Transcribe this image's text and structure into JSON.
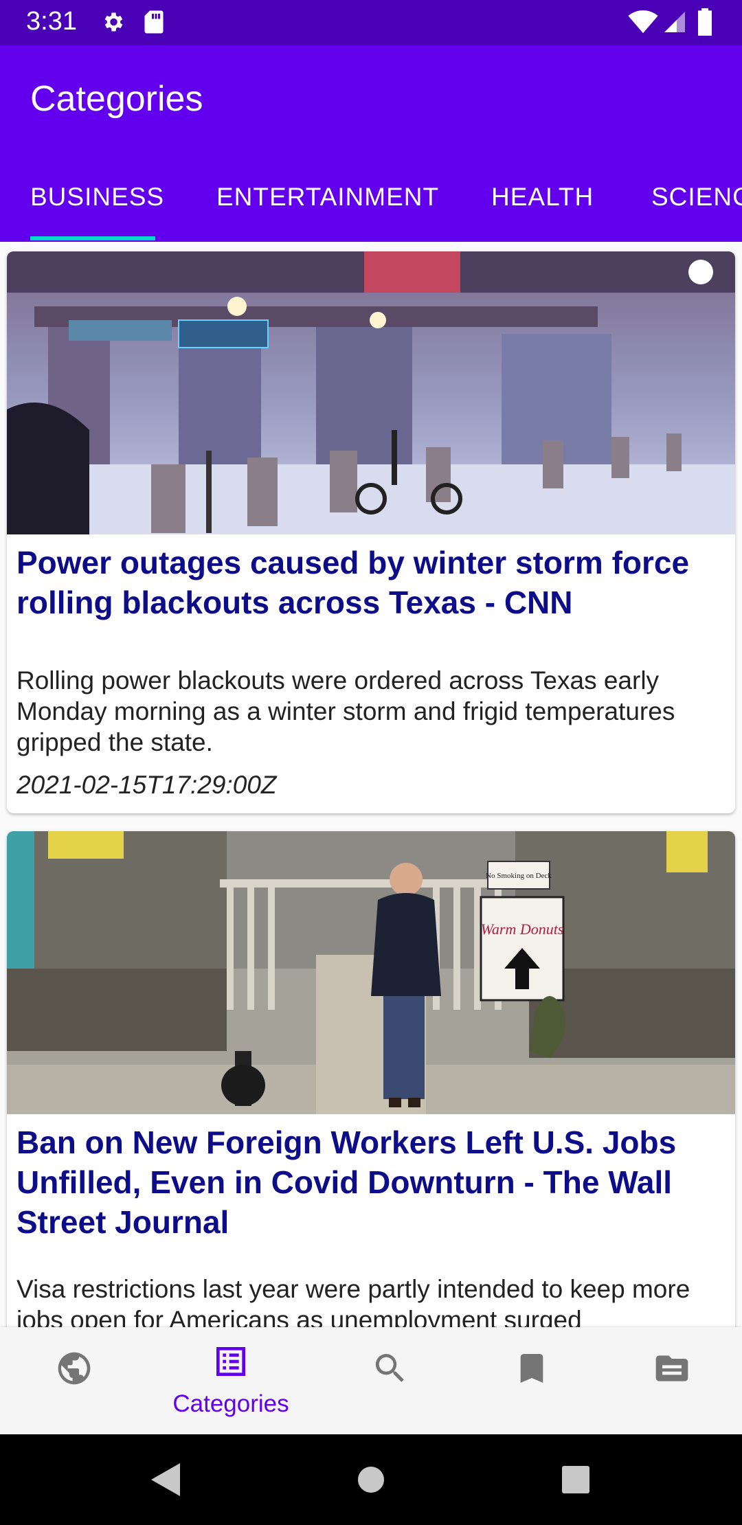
{
  "status_bar": {
    "time": "3:31",
    "icons": [
      "gear-icon",
      "sd-card-icon",
      "wifi-icon",
      "cellular-signal-icon",
      "battery-icon"
    ]
  },
  "app_bar": {
    "title": "Categories"
  },
  "tabs": [
    {
      "label": "BUSINESS",
      "selected": true
    },
    {
      "label": "ENTERTAINMENT",
      "selected": false
    },
    {
      "label": "HEALTH",
      "selected": false
    },
    {
      "label": "SCIENCE",
      "selected": false
    }
  ],
  "articles": [
    {
      "title": "Power outages caused by winter storm force rolling blackouts across Texas - CNN",
      "description": "Rolling power blackouts were ordered across Texas early Monday morning as a winter storm and frigid temperatures gripped the state.",
      "date": "2021-02-15T17:29:00Z"
    },
    {
      "title": "Ban on New Foreign Workers Left U.S. Jobs Unfilled, Even in Covid Downturn - The Wall Street Journal",
      "description": "Visa restrictions last year were partly intended to keep more jobs open for Americans as unemployment surged",
      "sign_top": "No Smoking on Deck",
      "sign_main": "Warm Donuts"
    }
  ],
  "bottom_nav": {
    "items": [
      {
        "icon": "globe-icon",
        "label": ""
      },
      {
        "icon": "list-icon",
        "label": "Categories",
        "selected": true
      },
      {
        "icon": "search-icon",
        "label": ""
      },
      {
        "icon": "bookmark-icon",
        "label": ""
      },
      {
        "icon": "sources-icon",
        "label": ""
      }
    ]
  },
  "colors": {
    "primary": "#6200ee",
    "status_bar": "#4a00b5",
    "tab_indicator": "#03dac5",
    "title_text": "#0d0d8a",
    "inactive_icon": "#757575"
  }
}
